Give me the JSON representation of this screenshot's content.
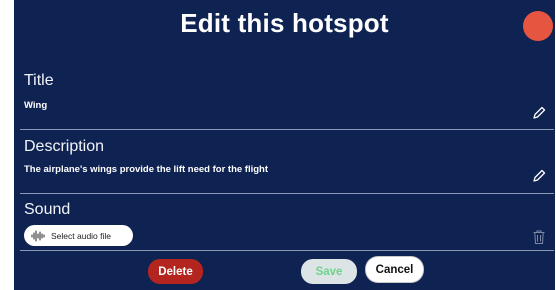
{
  "dialog": {
    "title": "Edit this hotspot"
  },
  "fields": {
    "title": {
      "label": "Title",
      "value": "Wing"
    },
    "description": {
      "label": "Description",
      "value": "The airplane's wings provide the lift need for the flight"
    },
    "sound": {
      "label": "Sound",
      "select_label": "Select audio file"
    }
  },
  "buttons": {
    "delete": "Delete",
    "save": "Save",
    "cancel": "Cancel"
  },
  "icons": {
    "edit": "pencil-icon",
    "audio": "audio-wave-icon",
    "trash": "trash-icon"
  },
  "colors": {
    "background": "#0f2352",
    "close": "#e6553f",
    "delete": "#b5251f",
    "save_text": "#6fd28a"
  }
}
